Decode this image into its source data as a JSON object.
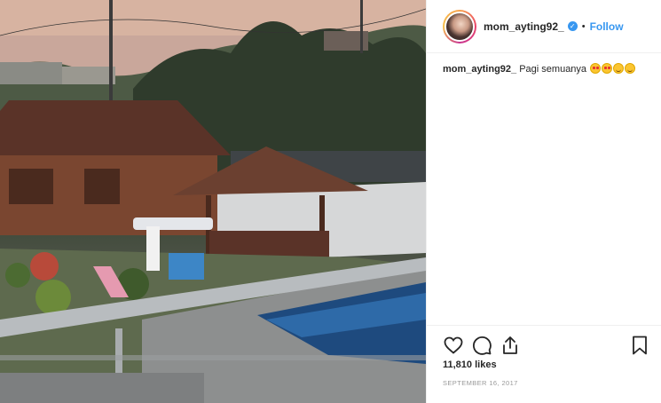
{
  "post": {
    "username": "mom_ayting92_",
    "follow_label": "Follow",
    "separator": "•",
    "caption_user": "mom_ayting92_",
    "caption_text": "Pagi semuanya",
    "caption_emojis": [
      "star-struck-emoji",
      "star-struck-emoji",
      "smiling-face-emoji",
      "smiling-face-emoji"
    ],
    "likes": "11,810 likes",
    "date": "SEPTEMBER 16, 2017"
  },
  "icons": {
    "verified": "verified-badge-icon",
    "like": "heart-icon",
    "comment": "comment-icon",
    "share": "share-icon",
    "save": "bookmark-icon"
  },
  "colors": {
    "accent": "#3897f0",
    "text": "#262626",
    "muted": "#999999",
    "border": "#efefef"
  }
}
